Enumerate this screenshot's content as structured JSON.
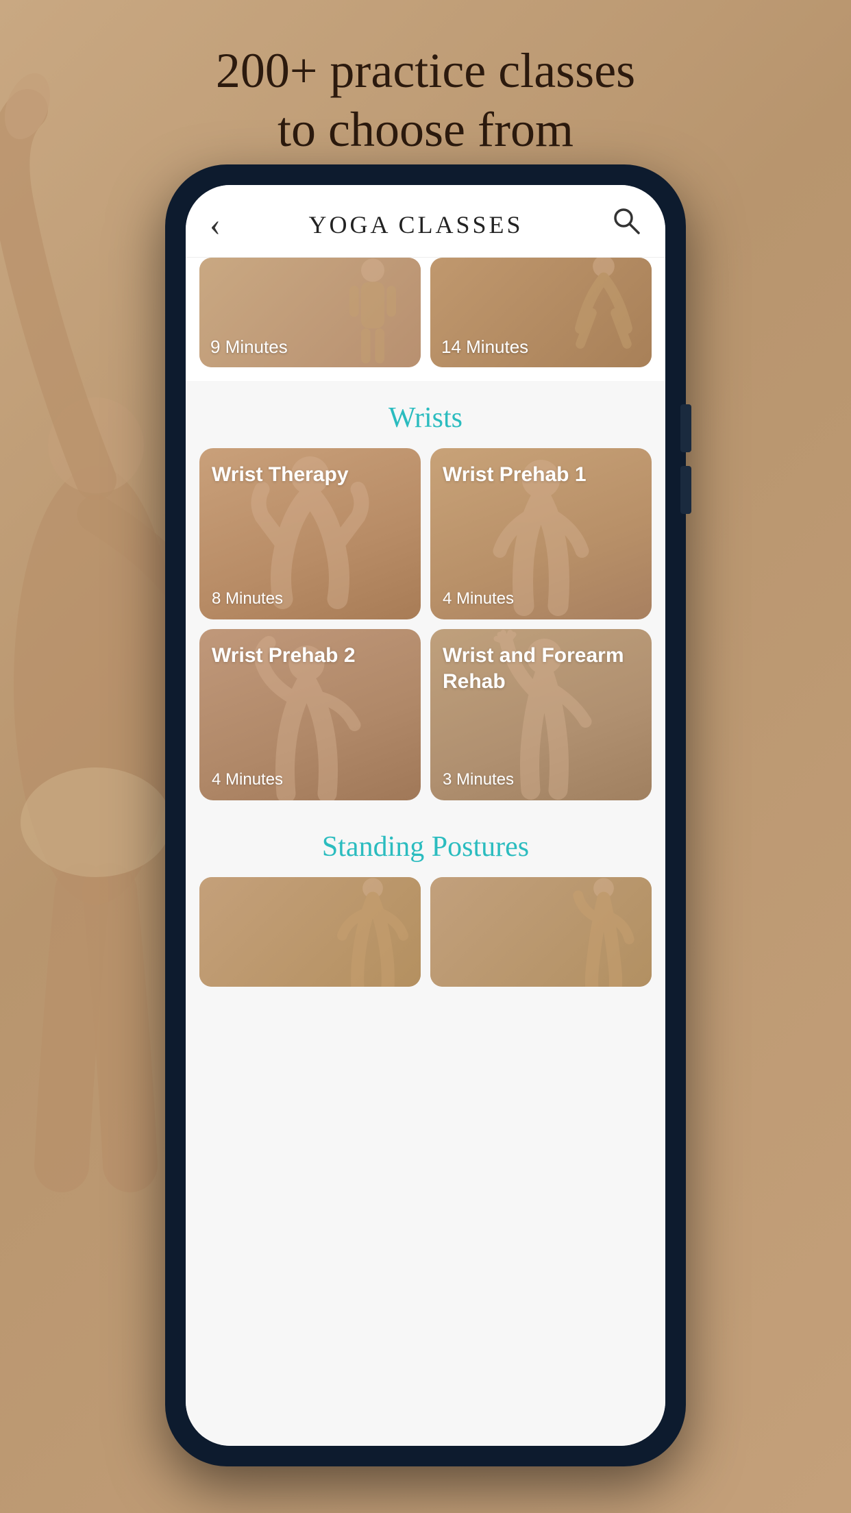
{
  "hero": {
    "line1": "200+ practice classes",
    "line2": "to choose from"
  },
  "header": {
    "back_label": "‹",
    "title": "Yoga Classes",
    "search_icon": "🔍"
  },
  "top_cards": [
    {
      "duration": "9 Minutes",
      "bg": "card-bg-1"
    },
    {
      "duration": "14 Minutes",
      "bg": "card-bg-2"
    }
  ],
  "sections": [
    {
      "label": "Wrists",
      "cards": [
        {
          "title": "Wrist Therapy",
          "duration": "8 Minutes",
          "bg": "card-bg-wrist1"
        },
        {
          "title": "Wrist Prehab 1",
          "duration": "4 Minutes",
          "bg": "card-bg-wrist2"
        },
        {
          "title": "Wrist Prehab 2",
          "duration": "4 Minutes",
          "bg": "card-bg-wrist3"
        },
        {
          "title": "Wrist and Forearm Rehab",
          "duration": "3 Minutes",
          "bg": "card-bg-wrist4"
        }
      ]
    },
    {
      "label": "Standing Postures",
      "cards": [
        {
          "title": "",
          "duration": "",
          "bg": "card-bg-standing1"
        },
        {
          "title": "",
          "duration": "",
          "bg": "card-bg-standing2"
        }
      ]
    }
  ]
}
